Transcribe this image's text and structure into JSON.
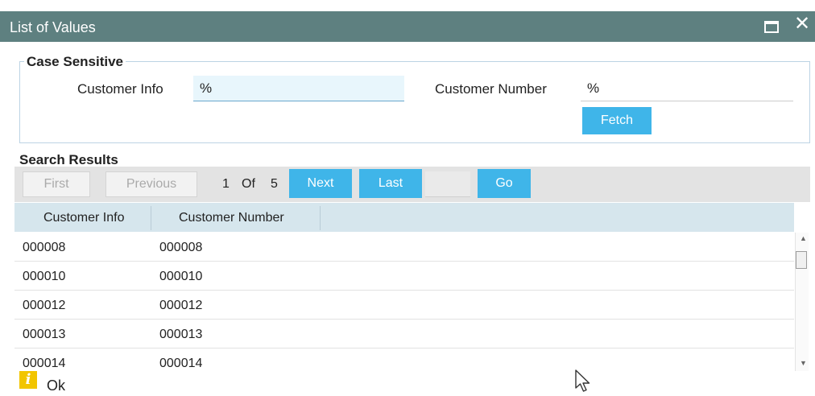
{
  "window": {
    "title": "List of Values"
  },
  "criteria": {
    "legend": "Case Sensitive",
    "customer_info_label": "Customer Info",
    "customer_info_value": "%",
    "customer_number_label": "Customer Number",
    "customer_number_value": "%",
    "fetch_label": "Fetch"
  },
  "results": {
    "title": "Search Results",
    "pager": {
      "first": "First",
      "previous": "Previous",
      "current_page": "1",
      "of_label": "Of",
      "total_pages": "5",
      "next": "Next",
      "last": "Last",
      "go": "Go"
    },
    "columns": [
      "Customer Info",
      "Customer Number"
    ],
    "rows": [
      [
        "000008",
        "000008"
      ],
      [
        "000010",
        "000010"
      ],
      [
        "000012",
        "000012"
      ],
      [
        "000013",
        "000013"
      ],
      [
        "000014",
        "000014"
      ]
    ]
  },
  "footer": {
    "ok_label": "Ok"
  },
  "colors": {
    "title_bar": "#5e8080",
    "accent_button": "#3fb5e9",
    "table_header": "#d6e6ed",
    "info_icon": "#f2c500"
  }
}
